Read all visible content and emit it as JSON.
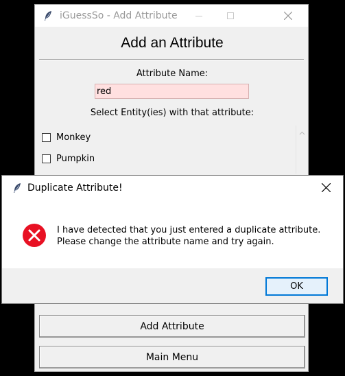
{
  "main_window": {
    "title": "iGuessSo - Add Attribute",
    "heading": "Add an Attribute",
    "attribute_name_label": "Attribute Name:",
    "attribute_name_value": "red",
    "select_label": "Select Entity(ies) with that attribute:",
    "entities": [
      {
        "label": "Monkey",
        "checked": false
      },
      {
        "label": "Pumpkin",
        "checked": false
      }
    ],
    "add_button_label": "Add Attribute",
    "main_menu_button_label": "Main Menu",
    "input_error_bg": "#ffe0e0"
  },
  "dialog": {
    "title": "Duplicate Attribute!",
    "message_line1": "I have detected that you just entered a duplicate attribute.",
    "message_line2": "Please change the attribute name and try again.",
    "ok_label": "OK",
    "icon": "error-icon",
    "error_color": "#e81123",
    "accent": "#0078d7"
  }
}
